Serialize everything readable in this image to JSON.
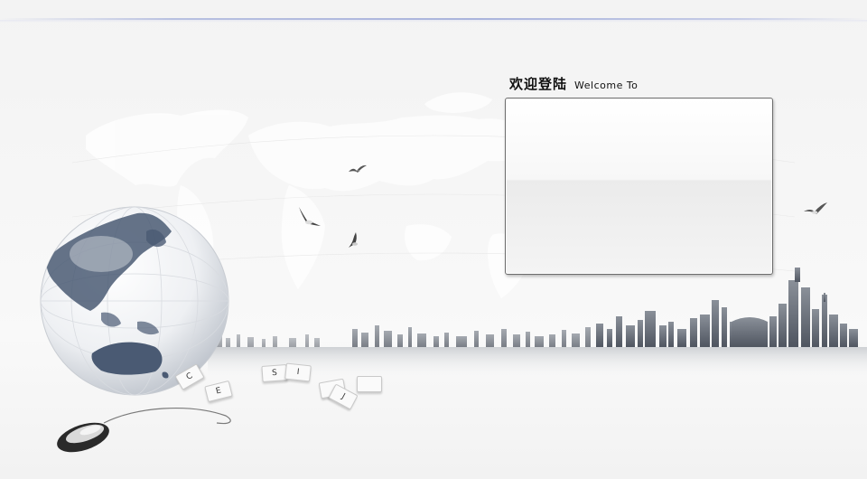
{
  "header": {
    "title_cn": "欢迎登陆",
    "title_en": "Welcome To"
  },
  "keys": {
    "c": "C",
    "e": "E",
    "s": "S",
    "i": "I",
    "j": "J",
    "blank1": "",
    "blank2": "",
    "blank3": ""
  },
  "colors": {
    "accent_line": "#aab4dc",
    "panel_border": "#6d6d6d",
    "globe_land": "#4a5a73"
  }
}
